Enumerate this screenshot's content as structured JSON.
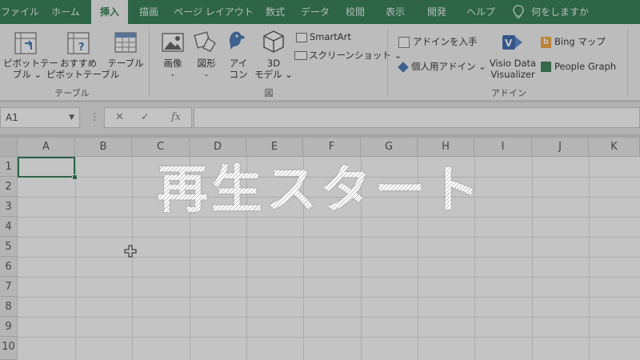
{
  "menu": {
    "tabs": [
      {
        "label": "ファイル",
        "active": false
      },
      {
        "label": "ホーム",
        "active": false
      },
      {
        "label": "挿入",
        "active": true
      },
      {
        "label": "描画",
        "active": false
      },
      {
        "label": "ページ レイアウト",
        "active": false
      },
      {
        "label": "数式",
        "active": false
      },
      {
        "label": "データ",
        "active": false
      },
      {
        "label": "校閲",
        "active": false
      },
      {
        "label": "表示",
        "active": false
      },
      {
        "label": "開発",
        "active": false
      },
      {
        "label": "ヘルプ",
        "active": false
      }
    ],
    "tell_me": "何をしますか"
  },
  "ribbon": {
    "tables": {
      "pivot_line1": "ピボットテー",
      "pivot_line2": "ブル ⌄",
      "recommended_line1": "おすすめ",
      "recommended_line2": "ピボットテーブル",
      "table": "テーブル",
      "group": "テーブル"
    },
    "illustrations": {
      "image": "画像",
      "shapes": "図形",
      "icons_line1": "アイ",
      "icons_line2": "コン",
      "model_line1": "3D",
      "model_line2": "モデル ⌄",
      "smartart": "SmartArt",
      "screenshot": "スクリーンショット ⌄",
      "group": "図"
    },
    "addins": {
      "get_addins": "アドインを入手",
      "my_addins": "個人用アドイン ⌄",
      "visio_line1": "Visio Data",
      "visio_line2": "Visualizer",
      "bing": "Bing マップ",
      "people": "People Graph",
      "group": "アドイン"
    }
  },
  "formula_bar": {
    "name_box": "A1",
    "fx": "fx"
  },
  "grid": {
    "columns": [
      "A",
      "B",
      "C",
      "D",
      "E",
      "F",
      "G",
      "H",
      "I",
      "J",
      "K"
    ],
    "rows": [
      "1",
      "2",
      "3",
      "4",
      "5",
      "6",
      "7",
      "8",
      "9",
      "10"
    ],
    "selected_cell": "A1"
  },
  "overlay": {
    "caption": "再生スタート"
  },
  "colors": {
    "brand": "#217346",
    "ribbon_bg": "#f3f3f3"
  }
}
